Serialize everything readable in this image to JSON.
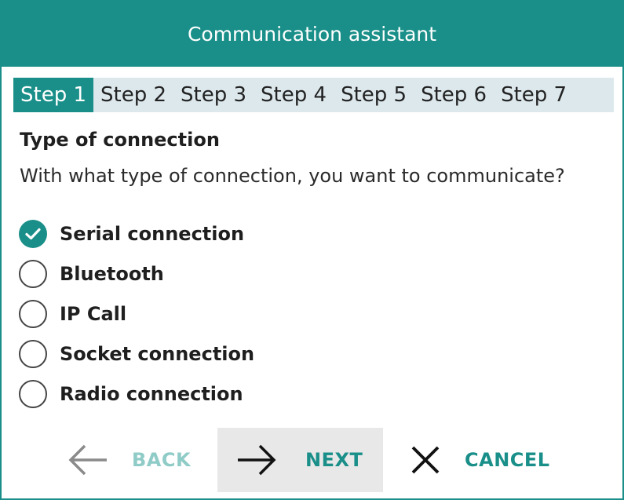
{
  "window": {
    "title": "Communication assistant"
  },
  "steps": [
    {
      "label": "Step 1",
      "active": true
    },
    {
      "label": "Step 2",
      "active": false
    },
    {
      "label": "Step 3",
      "active": false
    },
    {
      "label": "Step 4",
      "active": false
    },
    {
      "label": "Step 5",
      "active": false
    },
    {
      "label": "Step 6",
      "active": false
    },
    {
      "label": "Step 7",
      "active": false
    }
  ],
  "content": {
    "section_title": "Type of connection",
    "question": "With what type of connection, you want to communicate?",
    "options": [
      {
        "label": "Serial connection",
        "selected": true
      },
      {
        "label": "Bluetooth",
        "selected": false
      },
      {
        "label": "IP Call",
        "selected": false
      },
      {
        "label": "Socket connection",
        "selected": false
      },
      {
        "label": "Radio connection",
        "selected": false
      }
    ]
  },
  "footer": {
    "back": {
      "label": "BACK",
      "icon": "arrow-left-icon",
      "enabled": false
    },
    "next": {
      "label": "NEXT",
      "icon": "arrow-right-icon",
      "enabled": true
    },
    "cancel": {
      "label": "CANCEL",
      "icon": "close-icon",
      "enabled": true
    }
  },
  "colors": {
    "accent": "#1a8f89",
    "step_bar": "#dde8ec",
    "disabled_text": "#8fcbc7",
    "disabled_icon": "#8a8a8a",
    "next_button_bg": "#e8e8e8"
  }
}
